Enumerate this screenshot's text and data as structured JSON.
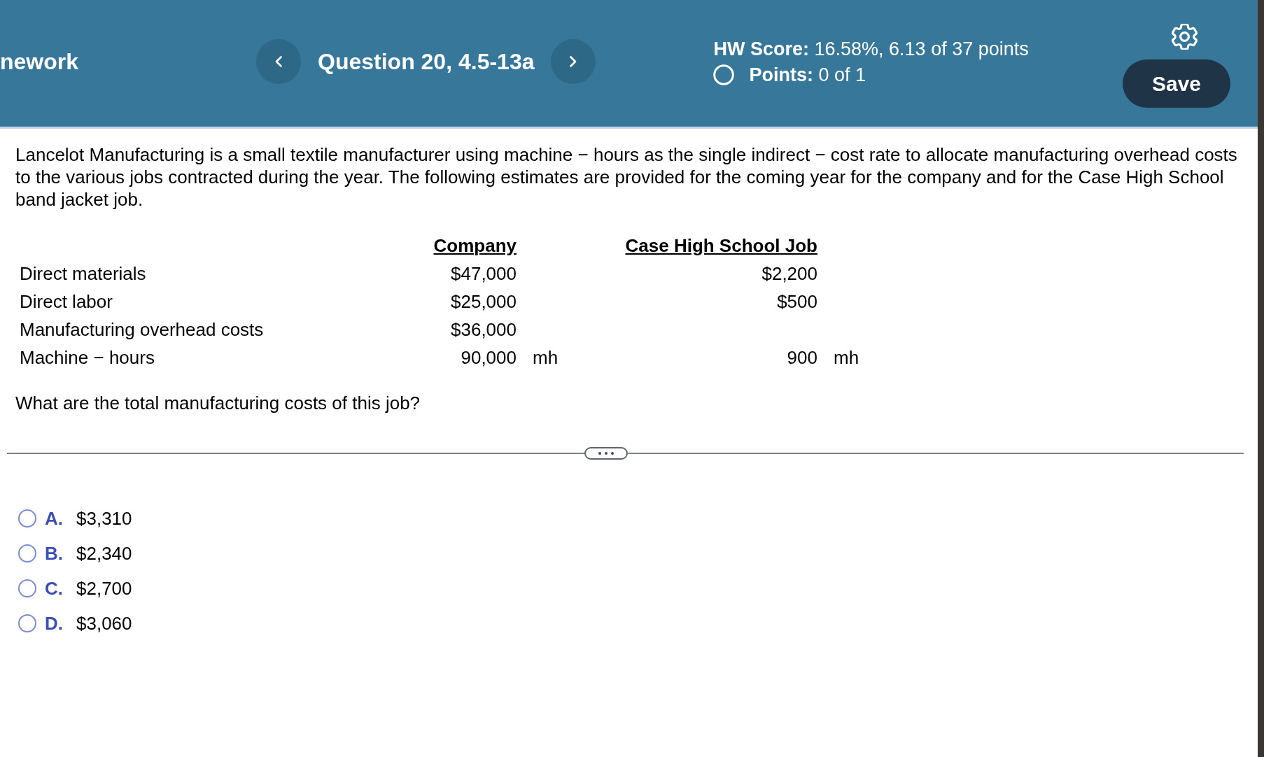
{
  "header": {
    "title": "nework",
    "question": "Question 20, 4.5-13a",
    "hw_score": {
      "label": "HW Score:",
      "value": "16.58%, 6.13 of 37 points"
    },
    "points": {
      "label": "Points:",
      "value": "0 of 1"
    },
    "save_button": "Save"
  },
  "problem": {
    "text": "Lancelot Manufacturing is a small textile manufacturer using machine − hours as the single indirect − cost rate to allocate manufacturing overhead costs to the various jobs contracted during the year. The following estimates are provided for the coming year for the company and for the Case High School band jacket job.",
    "table": {
      "columns": [
        "Company",
        "Case High School Job"
      ],
      "rows": [
        {
          "label": "Direct materials",
          "company": "$47,000",
          "job": "$2,200"
        },
        {
          "label": "Direct labor",
          "company": "$25,000",
          "job": "$500"
        },
        {
          "label": "Manufacturing overhead costs",
          "company": "$36,000"
        },
        {
          "label": "Machine − hours",
          "company": "90,000",
          "company_unit": "mh",
          "job": "900",
          "job_unit": "mh"
        }
      ]
    },
    "prompt": "What are the total manufacturing costs of this job?"
  },
  "choices": [
    {
      "letter": "A.",
      "text": "$3,310",
      "selected": false
    },
    {
      "letter": "B.",
      "text": "$2,340",
      "selected": false
    },
    {
      "letter": "C.",
      "text": "$2,700",
      "selected": false
    },
    {
      "letter": "D.",
      "text": "$3,060",
      "selected": false
    }
  ]
}
